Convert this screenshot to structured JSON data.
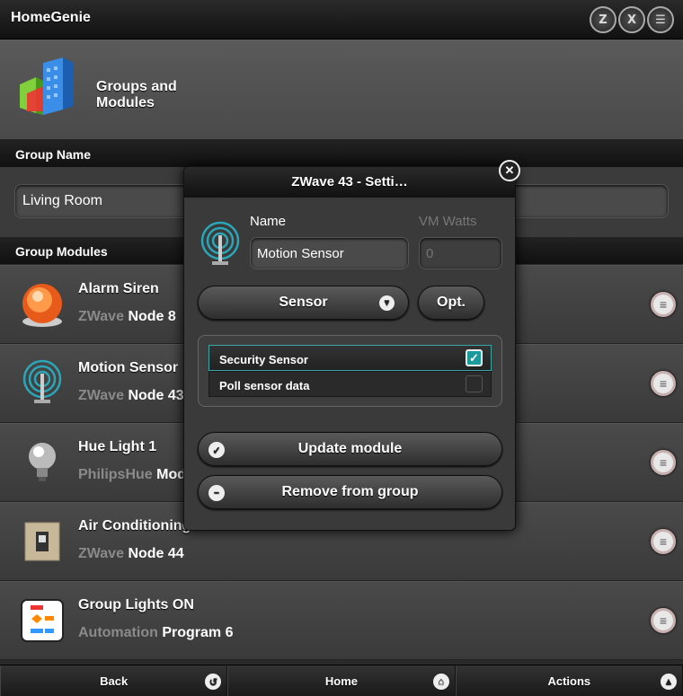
{
  "app": {
    "title": "HomeGenie"
  },
  "top_icons": [
    "zwave-icon",
    "x10-icon",
    "filter-icon"
  ],
  "top_icon_glyphs": {
    "zwave": "Z",
    "x10": "X",
    "filter": "☰"
  },
  "header": {
    "title": "Groups and Modules"
  },
  "group_name": {
    "label": "Group Name",
    "value": "Living Room"
  },
  "group_modules": {
    "label": "Group Modules",
    "items": [
      {
        "name": "Alarm Siren",
        "domain": "ZWave",
        "address": "Node 8",
        "icon": "alarm-siren-icon"
      },
      {
        "name": "Motion Sensor",
        "domain": "ZWave",
        "address": "Node 43",
        "icon": "motion-sensor-icon"
      },
      {
        "name": "Hue Light 1",
        "domain": "PhilipsHue",
        "address": "Mod",
        "icon": "light-bulb-icon"
      },
      {
        "name": "Air Conditioning",
        "domain": "ZWave",
        "address": "Node 44",
        "icon": "wall-switch-icon"
      },
      {
        "name": "Group Lights ON",
        "domain": "Automation",
        "address": "Program 6",
        "icon": "program-flow-icon"
      }
    ]
  },
  "footer": {
    "back": "Back",
    "home": "Home",
    "actions": "Actions"
  },
  "popup": {
    "title": "ZWave 43 - Setti…",
    "name_label": "Name",
    "name_value": "Motion Sensor",
    "watts_label": "VM Watts",
    "watts_placeholder": "0",
    "type_select": "Sensor",
    "options_button": "Opt.",
    "options": [
      {
        "label": "Security Sensor",
        "checked": true
      },
      {
        "label": "Poll sensor data",
        "checked": false
      }
    ],
    "update_button": "Update module",
    "remove_button": "Remove from group"
  },
  "colors": {
    "accent": "#1a9a9a",
    "bg": "#2a2a2a",
    "subtext": "#8a8a8a"
  }
}
